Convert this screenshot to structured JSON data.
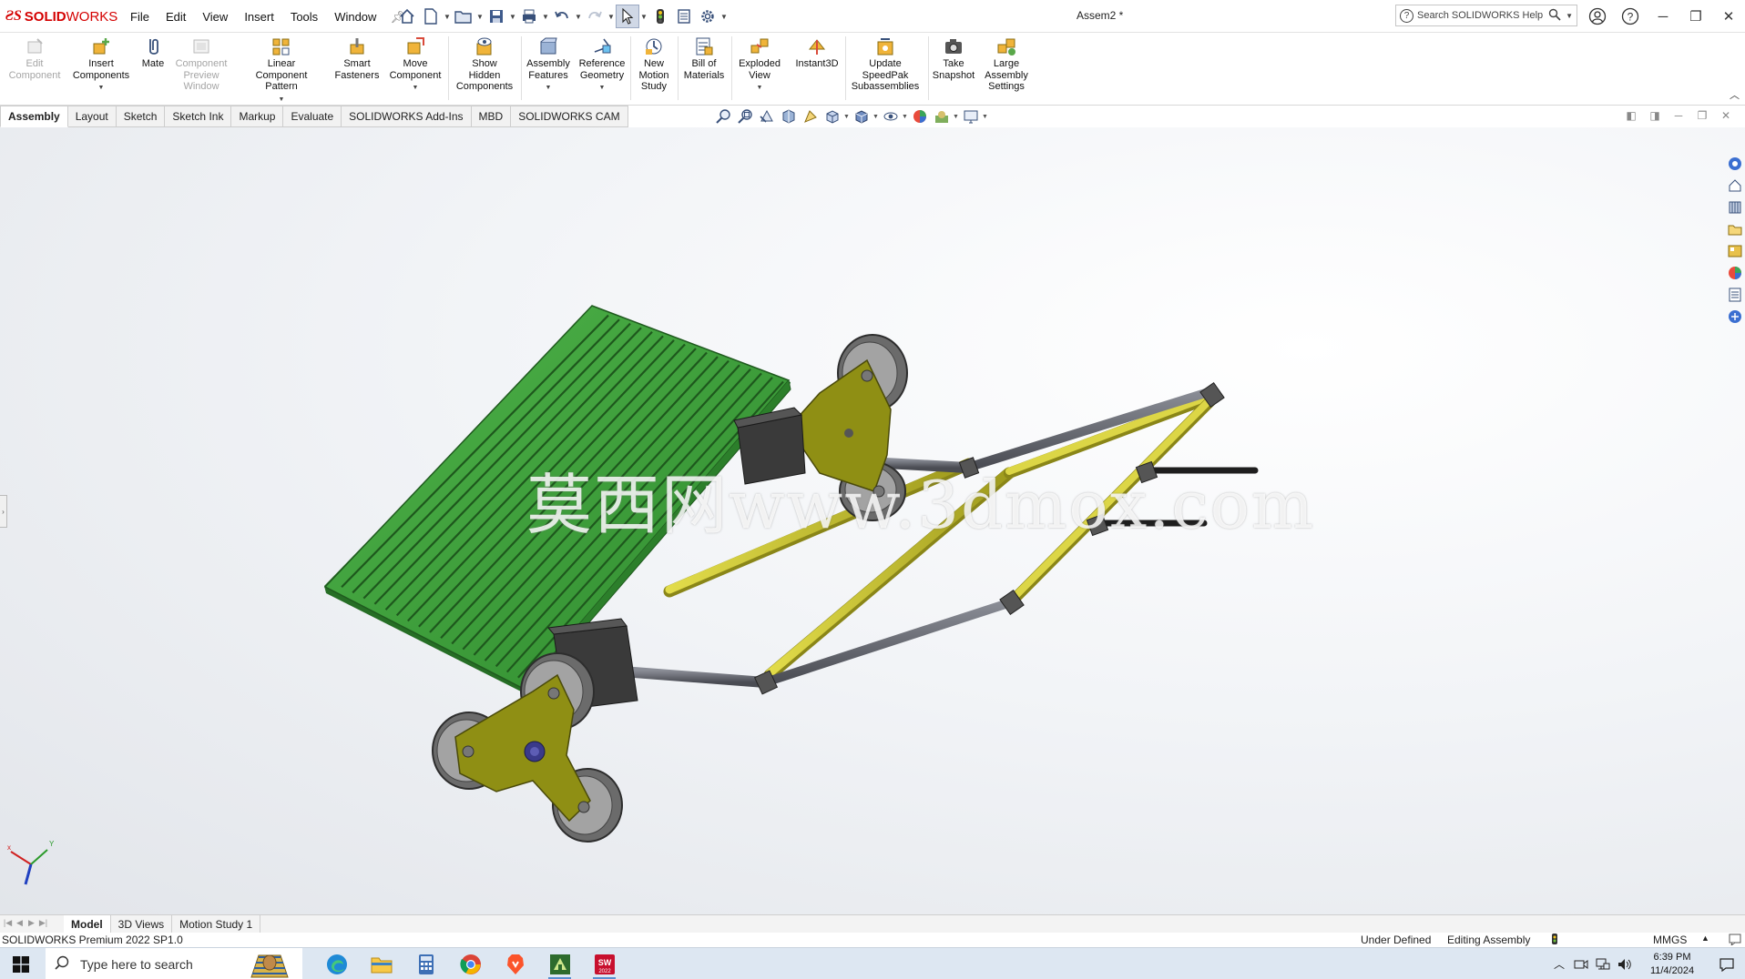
{
  "app": {
    "logo_ds": "ƧS",
    "logo_solid": "SOLID",
    "logo_works": "WORKS",
    "document_title": "Assem2 *"
  },
  "menu": {
    "items": [
      "File",
      "Edit",
      "View",
      "Insert",
      "Tools",
      "Window"
    ]
  },
  "search": {
    "placeholder": "Search SOLIDWORKS Help"
  },
  "commands": [
    {
      "label": "Edit\nComponent",
      "disabled": true
    },
    {
      "label": "Insert\nComponents",
      "disabled": false
    },
    {
      "label": "Mate",
      "disabled": false
    },
    {
      "label": "Component\nPreview\nWindow",
      "disabled": true
    },
    {
      "label": "Linear Component\nPattern",
      "disabled": false
    },
    {
      "label": "Smart\nFasteners",
      "disabled": false
    },
    {
      "label": "Move\nComponent",
      "disabled": false
    },
    {
      "label": "Show\nHidden\nComponents",
      "disabled": false
    },
    {
      "label": "Assembly\nFeatures",
      "disabled": false
    },
    {
      "label": "Reference\nGeometry",
      "disabled": false
    },
    {
      "label": "New\nMotion\nStudy",
      "disabled": false
    },
    {
      "label": "Bill of\nMaterials",
      "disabled": false
    },
    {
      "label": "Exploded\nView",
      "disabled": false
    },
    {
      "label": "Instant3D",
      "disabled": false
    },
    {
      "label": "Update\nSpeedPak\nSubassemblies",
      "disabled": false
    },
    {
      "label": "Take\nSnapshot",
      "disabled": false
    },
    {
      "label": "Large\nAssembly\nSettings",
      "disabled": false
    }
  ],
  "tabs": [
    {
      "label": "Assembly",
      "active": true
    },
    {
      "label": "Layout",
      "active": false
    },
    {
      "label": "Sketch",
      "active": false
    },
    {
      "label": "Sketch Ink",
      "active": false
    },
    {
      "label": "Markup",
      "active": false
    },
    {
      "label": "Evaluate",
      "active": false
    },
    {
      "label": "SOLIDWORKS Add-Ins",
      "active": false
    },
    {
      "label": "MBD",
      "active": false
    },
    {
      "label": "SOLIDWORKS CAM",
      "active": false
    }
  ],
  "viewport": {
    "watermark": "莫西网www.3dmox.com",
    "colors": {
      "platform": "#3c9a38",
      "frame": "#b9b526",
      "plate": "#8f8f14",
      "rod": "#5e6069",
      "wheel": "#8a8a8a",
      "block": "#3d3d3d"
    }
  },
  "bottom_tabs": [
    {
      "label": "Model",
      "active": true
    },
    {
      "label": "3D Views",
      "active": false
    },
    {
      "label": "Motion Study 1",
      "active": false
    }
  ],
  "status": {
    "product": "SOLIDWORKS Premium 2022 SP1.0",
    "state": "Under Defined",
    "mode": "Editing Assembly",
    "units": "MMGS"
  },
  "taskbar": {
    "search_placeholder": "Type here to search",
    "time": "6:39 PM",
    "date": "11/4/2024"
  }
}
